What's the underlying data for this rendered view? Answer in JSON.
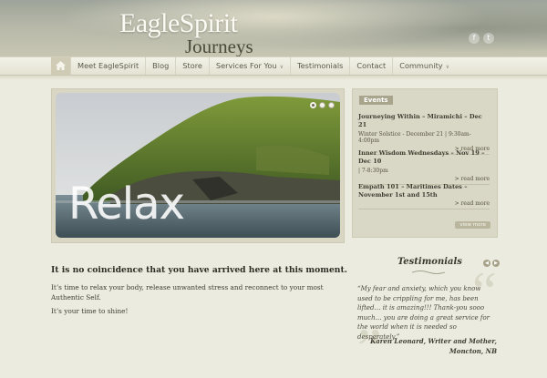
{
  "brand": {
    "line1": "EagleSpirit",
    "line2": "Journeys"
  },
  "social": [
    {
      "icon": "facebook-icon",
      "glyph": "f"
    },
    {
      "icon": "twitter-icon",
      "glyph": "t"
    }
  ],
  "nav": {
    "home_icon": "home-icon",
    "items": [
      {
        "label": "Meet EagleSpirit",
        "dropdown": false
      },
      {
        "label": "Blog",
        "dropdown": false
      },
      {
        "label": "Store",
        "dropdown": false
      },
      {
        "label": "Services For You",
        "dropdown": true
      },
      {
        "label": "Testimonials",
        "dropdown": false
      },
      {
        "label": "Contact",
        "dropdown": false
      },
      {
        "label": "Community",
        "dropdown": true
      }
    ]
  },
  "slider": {
    "caption": "Relax",
    "slide_count": 3,
    "active_slide": 1
  },
  "events": {
    "heading": "Events",
    "items": [
      {
        "title": "Journeying Within – Miramichi – Dec 21",
        "date": "Winter Solstice - December 21 | 9:30am-4:00pm",
        "more": "> read more"
      },
      {
        "title": "Inner Wisdom Wednesdays – Nov 19 – Dec 10",
        "date": "| 7-8:30pm",
        "more": "> read more"
      },
      {
        "title": "Empath 101 – Maritimes Dates – November 1st and 15th",
        "date": "",
        "more": "> read more"
      }
    ],
    "view_more": "view more"
  },
  "main": {
    "headline": "It is no coincidence that you have arrived here at this moment.",
    "paragraph1": "It’s time to relax your body,  release unwanted stress and reconnect to your most Authentic Self.",
    "paragraph2": "It’s your time to shine!"
  },
  "testimonials": {
    "title": "Testimonials",
    "quote": "“My fear and anxiety, which you know used to be crippling for me, has been lifted… it is amazing!!! Thank-you sooo much… you are doing a great service for the world when it is needed so desperately.”",
    "author_line1": "Karen Leonard, Writer and Mother,",
    "author_line2": "Moncton, NB"
  }
}
